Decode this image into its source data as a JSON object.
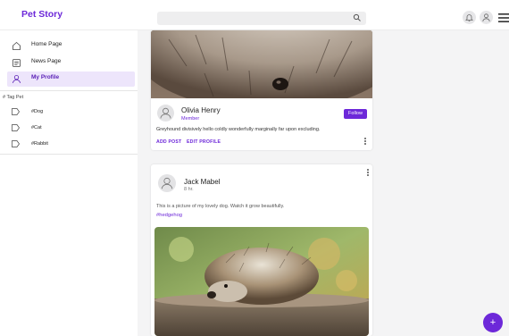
{
  "app": {
    "brand": "Pet Story"
  },
  "header": {
    "search_placeholder": ""
  },
  "sidebar": {
    "items": [
      {
        "label": "Home Page",
        "icon": "home-icon"
      },
      {
        "label": "News Page",
        "icon": "news-icon"
      },
      {
        "label": "My Profile",
        "icon": "user-icon",
        "active": true
      }
    ],
    "tag_header": "# Tag Pet",
    "tags": [
      {
        "label": "#Dog",
        "icon": "tag-icon"
      },
      {
        "label": "#Cat",
        "icon": "tag-icon"
      },
      {
        "label": "#Rabbit",
        "icon": "tag-icon"
      }
    ]
  },
  "profile": {
    "name": "Olivia Henry",
    "role": "Member",
    "bio": "Greyhound divisively hello coldly wonderfully marginally far upon excluding.",
    "follow_label": "Follow",
    "add_post": "ADD POST",
    "edit_profile": "EDIT PROFILE"
  },
  "post": {
    "author": "Jack Mabel",
    "time": "8 hr.",
    "text": "This is a picture of my lovely dog. Watch it grow beautifully.",
    "hashtag": "#hedgehog"
  },
  "fab": {
    "label": "+"
  },
  "colors": {
    "accent": "#6d28d9",
    "active_bg": "#ede5fb"
  }
}
